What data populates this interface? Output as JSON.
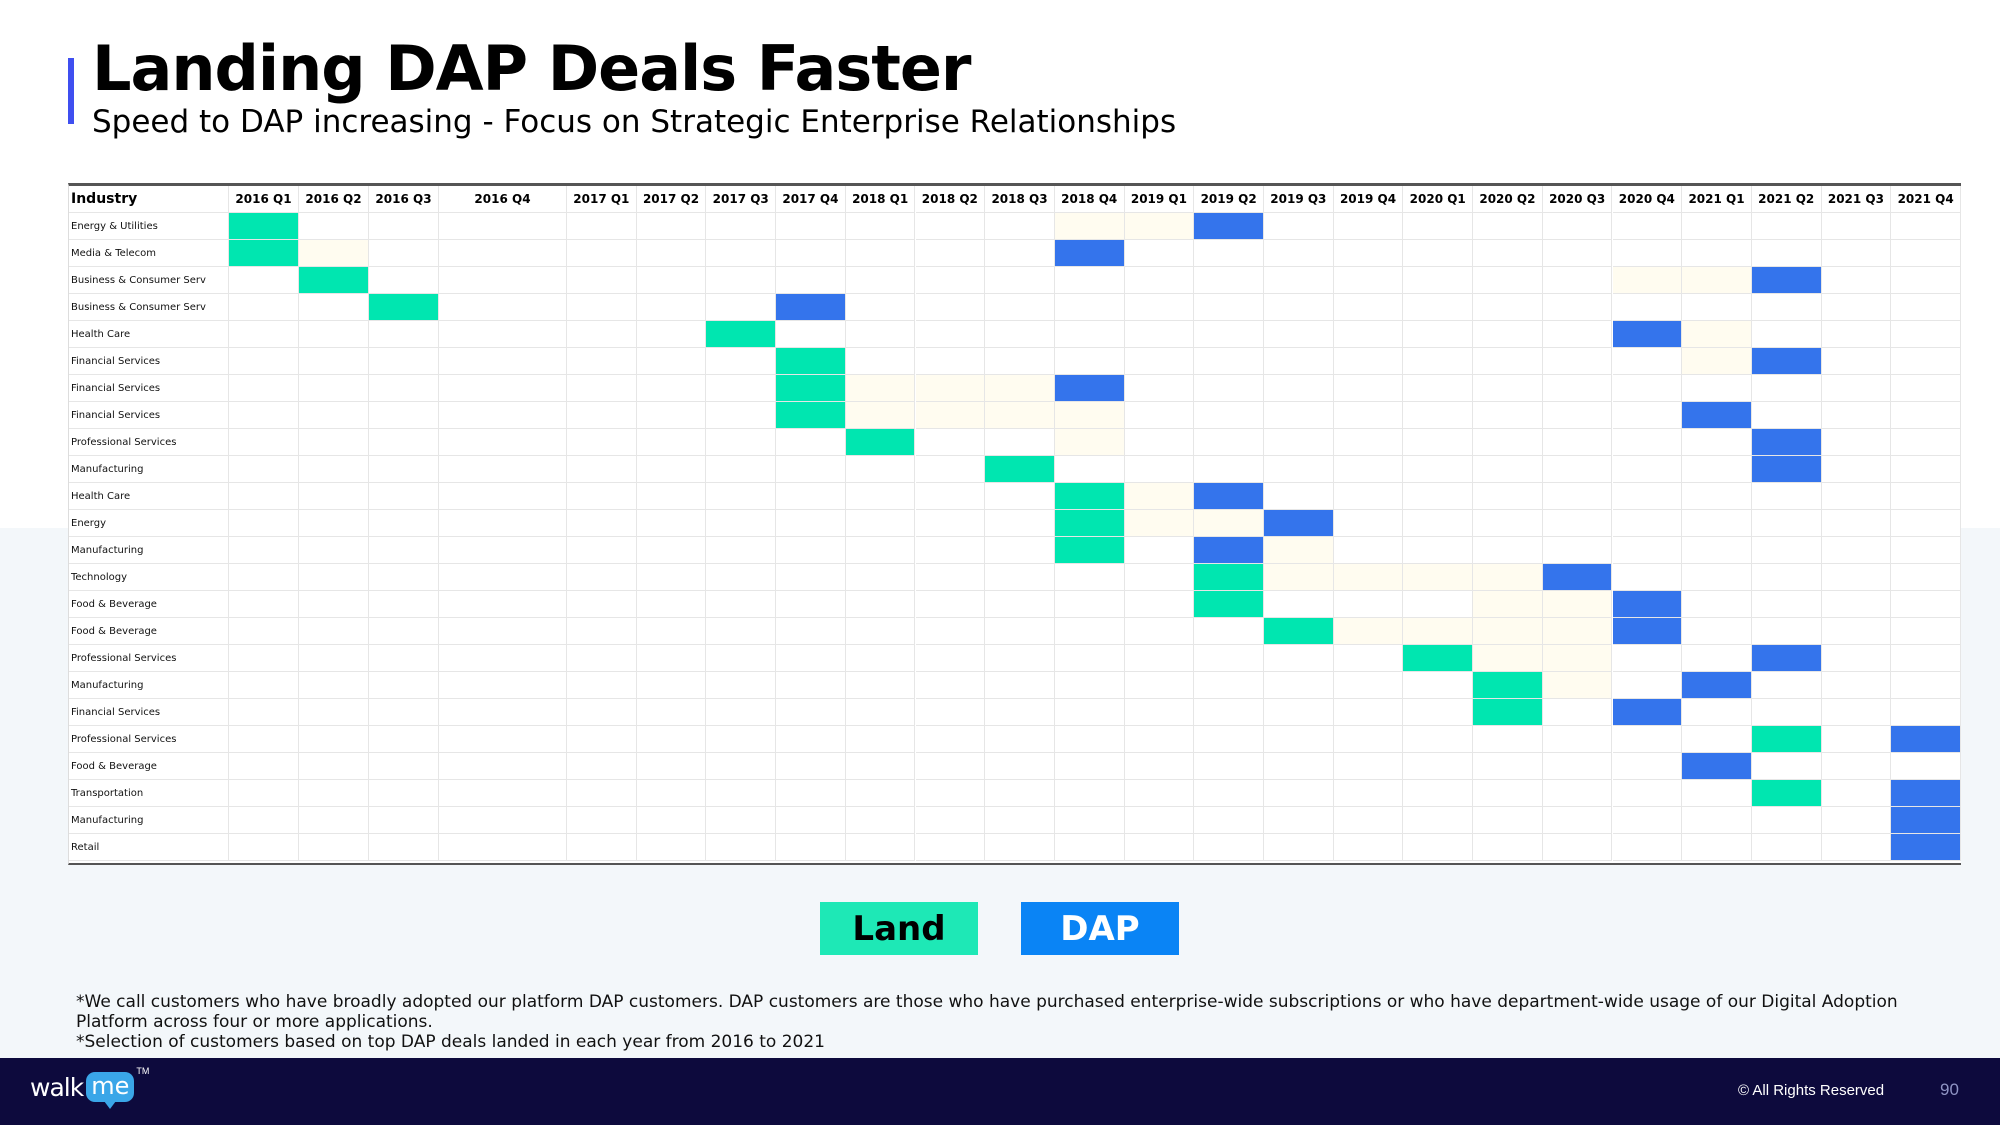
{
  "header": {
    "title": "Landing DAP Deals Faster",
    "subtitle": "Speed to DAP increasing - Focus on Strategic Enterprise Relationships"
  },
  "colors": {
    "land": "#00e6b0",
    "dap": "#3474ec",
    "faint": "#fffcf0",
    "accent": "#3f4ff0",
    "footer_bg": "#0d0a3d"
  },
  "chart_data": {
    "type": "table",
    "title": "Landing DAP Deals Faster",
    "legend": [
      {
        "key": "land",
        "label": "Land"
      },
      {
        "key": "dap",
        "label": "DAP"
      }
    ],
    "legend_placement": "bottom",
    "row_header": "Industry",
    "columns": [
      "2016 Q1",
      "2016 Q2",
      "2016 Q3",
      "2016 Q4",
      "2017 Q1",
      "2017 Q2",
      "2017 Q3",
      "2017 Q4",
      "2018 Q1",
      "2018 Q2",
      "2018 Q3",
      "2018 Q4",
      "2019 Q1",
      "2019 Q2",
      "2019 Q3",
      "2019 Q4",
      "2020 Q1",
      "2020 Q2",
      "2020 Q3",
      "2020 Q4",
      "2021 Q1",
      "2021 Q2",
      "2021 Q3",
      "2021 Q4"
    ],
    "rows": [
      {
        "industry": "Energy & Utilities",
        "land": "2016 Q1",
        "dap": "2019 Q2",
        "faint": [
          "2018 Q4",
          "2019 Q1"
        ]
      },
      {
        "industry": "Media & Telecom",
        "land": "2016 Q1",
        "dap": "2018 Q4",
        "faint": [
          "2016 Q2"
        ]
      },
      {
        "industry": "Business & Consumer Serv",
        "land": "2016 Q2",
        "dap": "2021 Q2",
        "faint": [
          "2020 Q4",
          "2021 Q1"
        ]
      },
      {
        "industry": "Business & Consumer Serv",
        "land": "2016 Q3",
        "dap": "2017 Q4",
        "faint": []
      },
      {
        "industry": "Health Care",
        "land": "2017 Q3",
        "dap": "2020 Q4",
        "faint": [
          "2021 Q1"
        ]
      },
      {
        "industry": "Financial Services",
        "land": "2017 Q4",
        "dap": "2021 Q2",
        "faint": [
          "2021 Q1"
        ]
      },
      {
        "industry": "Financial Services",
        "land": "2017 Q4",
        "dap": "2018 Q4",
        "faint": [
          "2018 Q1",
          "2018 Q2",
          "2018 Q3"
        ]
      },
      {
        "industry": "Financial Services",
        "land": "2017 Q4",
        "dap": "2021 Q1",
        "faint": [
          "2018 Q1",
          "2018 Q2",
          "2018 Q3",
          "2018 Q4"
        ]
      },
      {
        "industry": "Professional Services",
        "land": "2018 Q1",
        "dap": "2021 Q2",
        "faint": [
          "2018 Q4"
        ]
      },
      {
        "industry": "Manufacturing",
        "land": "2018 Q3",
        "dap": "2021 Q2",
        "faint": []
      },
      {
        "industry": "Health Care",
        "land": "2018 Q4",
        "dap": "2019 Q2",
        "faint": [
          "2019 Q1"
        ]
      },
      {
        "industry": "Energy",
        "land": "2018 Q4",
        "dap": "2019 Q3",
        "faint": [
          "2019 Q1",
          "2019 Q2"
        ]
      },
      {
        "industry": "Manufacturing",
        "land": "2018 Q4",
        "dap": "2019 Q2",
        "faint": [
          "2019 Q3"
        ]
      },
      {
        "industry": "Technology",
        "land": "2019 Q2",
        "dap": "2020 Q3",
        "faint": [
          "2019 Q3",
          "2019 Q4",
          "2020 Q1",
          "2020 Q2"
        ]
      },
      {
        "industry": "Food & Beverage",
        "land": "2019 Q2",
        "dap": "2020 Q4",
        "faint": [
          "2020 Q2",
          "2020 Q3"
        ]
      },
      {
        "industry": "Food & Beverage",
        "land": "2019 Q3",
        "dap": "2020 Q4",
        "faint": [
          "2019 Q4",
          "2020 Q1",
          "2020 Q2",
          "2020 Q3"
        ]
      },
      {
        "industry": "Professional Services",
        "land": "2020 Q1",
        "dap": "2021 Q2",
        "faint": [
          "2020 Q2",
          "2020 Q3"
        ]
      },
      {
        "industry": "Manufacturing",
        "land": "2020 Q2",
        "dap": "2021 Q1",
        "faint": [
          "2020 Q3"
        ]
      },
      {
        "industry": "Financial Services",
        "land": "2020 Q2",
        "dap": "2020 Q4",
        "faint": []
      },
      {
        "industry": "Professional Services",
        "land": "2021 Q2",
        "dap": "2021 Q4",
        "faint": []
      },
      {
        "industry": "Food & Beverage",
        "land": null,
        "dap": "2021 Q1",
        "faint": []
      },
      {
        "industry": "Transportation",
        "land": "2021 Q2",
        "dap": "2021 Q4",
        "faint": []
      },
      {
        "industry": "Manufacturing",
        "land": null,
        "dap": "2021 Q4",
        "faint": []
      },
      {
        "industry": "Retail",
        "land": null,
        "dap": "2021 Q4",
        "faint": []
      }
    ]
  },
  "legend": {
    "land_label": "Land",
    "dap_label": "DAP"
  },
  "footnotes": {
    "line1": "*We call customers who have broadly adopted our platform DAP customers. DAP customers are those  who have purchased enterprise-wide subscriptions or who have department-wide usage of our Digital Adoption Platform across four or more applications.",
    "line2": "*Selection of customers based on top DAP deals landed in each year from 2016 to 2021"
  },
  "footer": {
    "logo_walk": "walk",
    "logo_me": "me",
    "logo_tm": "TM",
    "copyright": "© All Rights Reserved",
    "page_number": "90"
  }
}
